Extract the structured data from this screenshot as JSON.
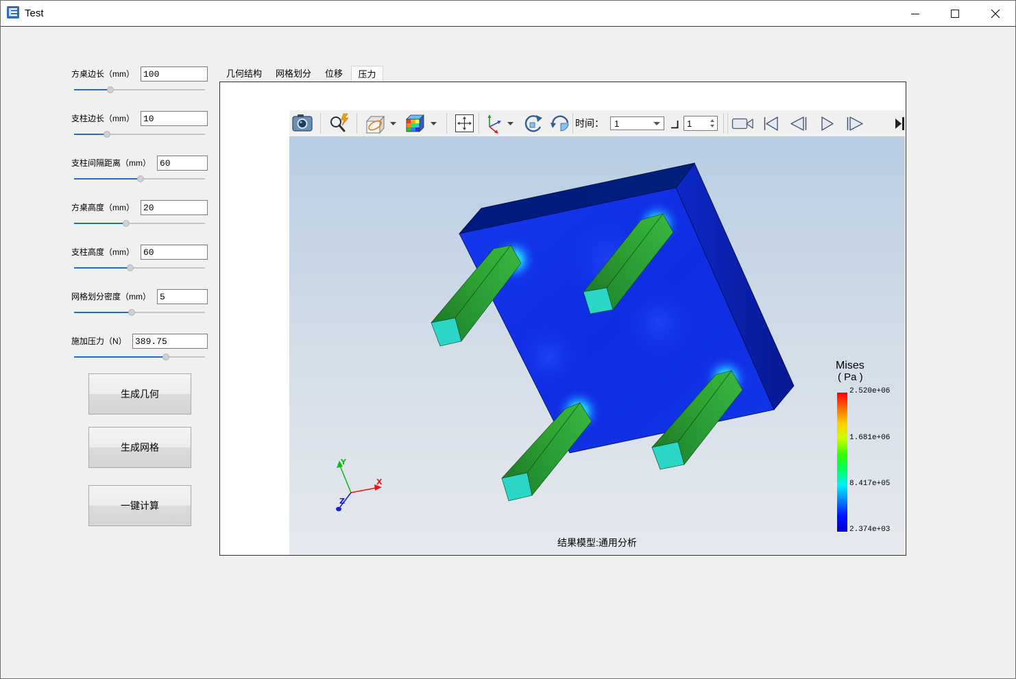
{
  "window": {
    "title": "Test",
    "icon": "app-icon",
    "controls": [
      "minimize-icon",
      "maximize-icon",
      "close-icon"
    ]
  },
  "params": [
    {
      "label": "方桌边长（mm）",
      "value": "100",
      "level": 0.28
    },
    {
      "label": "支柱边长（mm）",
      "value": "10",
      "level": 0.25
    },
    {
      "label": "支柱间隔距离（mm）",
      "value": "60",
      "level": 0.51
    },
    {
      "label": "方桌高度（mm）",
      "value": "20",
      "level": 0.4
    },
    {
      "label": "支柱高度（mm）",
      "value": "60",
      "level": 0.43
    },
    {
      "label": "网格划分密度（mm）",
      "value": "5",
      "level": 0.44
    },
    {
      "label": "施加压力（N）",
      "value": "389.75",
      "level": 0.7
    }
  ],
  "buttons": {
    "generate_geometry": "生成几何",
    "generate_mesh": "生成网格",
    "one_click_compute": "一键计算"
  },
  "tabs": [
    {
      "label": "几何结构",
      "active": false
    },
    {
      "label": "网格划分",
      "active": false
    },
    {
      "label": "位移",
      "active": false
    },
    {
      "label": "压力",
      "active": true
    }
  ],
  "viewer": {
    "toolbar": {
      "icons": [
        "camera-icon",
        "zoom-icon",
        "clip-plane-icon",
        "color-map-icon",
        "fit-view-icon",
        "axes-icon",
        "rotate-cw-icon",
        "rotate-ccw-icon",
        "step-size-icon",
        "record-icon",
        "first-frame-icon",
        "prev-frame-icon",
        "play-icon",
        "next-frame-icon",
        "last-frame-icon"
      ],
      "time_label": "时间：",
      "time_value": "1",
      "step_value": "1"
    },
    "legend": {
      "title": "Mises",
      "unit": "( Pa )",
      "ticks": [
        "2.520e+06",
        "1.681e+06",
        "8.417e+05",
        "2.374e+03"
      ],
      "colors": [
        "#ff0000",
        "#ff6a00",
        "#ffd000",
        "#c8ff00",
        "#30ff00",
        "#00ff60",
        "#00f0ff",
        "#0080ff",
        "#0010ff",
        "#0000d0"
      ]
    },
    "axes": {
      "x": "X",
      "y": "Y",
      "z": "Z"
    },
    "caption": "结果模型:通用分析"
  },
  "colors": {
    "slider_fill": "#1e6fc6",
    "plate": "#1232e6",
    "pillar": "#2a9a30",
    "pillar_end": "#2ad8c8"
  }
}
